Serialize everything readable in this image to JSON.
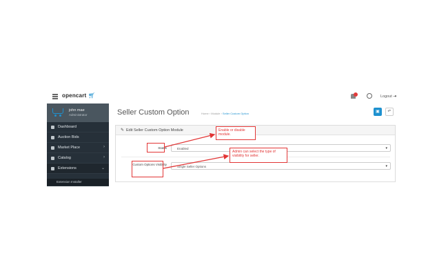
{
  "header": {
    "logo_text": "opencart",
    "logout_label": "Logout"
  },
  "sidebar": {
    "profile_name": "john mae",
    "profile_role": "Administrator",
    "items": [
      {
        "label": "Dashboard"
      },
      {
        "label": "Auction Bids"
      },
      {
        "label": "Market Place"
      },
      {
        "label": "Catalog"
      },
      {
        "label": "Extensions"
      }
    ],
    "sub_item": "Extension Installer"
  },
  "main": {
    "page_title": "Seller Custom Option",
    "breadcrumbs": [
      "Home",
      "Module",
      "Seller Custom Option"
    ],
    "panel_title": "Edit Seller Custom Option Module",
    "fields": [
      {
        "label": "Status",
        "value": "Enabled"
      },
      {
        "label": "Custom Options Visibility",
        "value": "Single Seller Options"
      }
    ]
  },
  "annotations": {
    "status_note": "Enable or disable module.",
    "visibility_note": "Admin can select the type of visibility for seller."
  },
  "colors": {
    "accent": "#1e91cf",
    "sidebar_bg": "#263039",
    "annotation_red": "#e23434"
  }
}
